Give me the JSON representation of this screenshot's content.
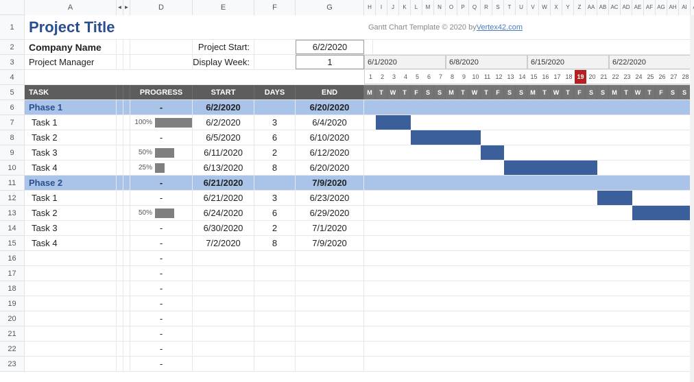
{
  "chart_data": {
    "type": "gantt",
    "title": "Project Title",
    "x_start": "6/1/2020",
    "weeks": [
      "6/1/2020",
      "6/8/2020",
      "6/15/2020",
      "6/22/2020"
    ],
    "today": "6/19/2020",
    "tasks": [
      {
        "name": "Phase 1",
        "type": "phase",
        "start": "6/2/2020",
        "end": "6/20/2020",
        "days": null,
        "progress": null
      },
      {
        "name": "Task 1",
        "type": "task",
        "start": "6/2/2020",
        "end": "6/4/2020",
        "days": 3,
        "progress": 100
      },
      {
        "name": "Task 2",
        "type": "task",
        "start": "6/5/2020",
        "end": "6/10/2020",
        "days": 6,
        "progress": null
      },
      {
        "name": "Task 3",
        "type": "task",
        "start": "6/11/2020",
        "end": "6/12/2020",
        "days": 2,
        "progress": 50
      },
      {
        "name": "Task 4",
        "type": "task",
        "start": "6/13/2020",
        "end": "6/20/2020",
        "days": 8,
        "progress": 25
      },
      {
        "name": "Phase 2",
        "type": "phase",
        "start": "6/21/2020",
        "end": "7/9/2020",
        "days": null,
        "progress": null
      },
      {
        "name": "Task 1",
        "type": "task",
        "start": "6/21/2020",
        "end": "6/23/2020",
        "days": 3,
        "progress": null
      },
      {
        "name": "Task 2",
        "type": "task",
        "start": "6/24/2020",
        "end": "6/29/2020",
        "days": 6,
        "progress": 50
      },
      {
        "name": "Task 3",
        "type": "task",
        "start": "6/30/2020",
        "end": "7/1/2020",
        "days": 2,
        "progress": null
      },
      {
        "name": "Task 4",
        "type": "task",
        "start": "7/2/2020",
        "end": "7/9/2020",
        "days": 8,
        "progress": null
      }
    ]
  },
  "cols_wide": [
    "A",
    "",
    "",
    "D",
    "E",
    "F",
    "G"
  ],
  "cols_narrow": [
    "H",
    "I",
    "J",
    "K",
    "L",
    "M",
    "N",
    "O",
    "P",
    "Q",
    "R",
    "S",
    "T",
    "U",
    "V",
    "W",
    "X",
    "Y",
    "Z",
    "AA",
    "AB",
    "AC",
    "AD",
    "AE",
    "AF",
    "AG",
    "AH",
    "AI",
    "AJ"
  ],
  "collapse_label_left": "◄",
  "collapse_label_right": "►",
  "header": {
    "title": "Project Title",
    "company_label": "Company Name",
    "manager_label": "Project Manager",
    "start_label": "Project Start:",
    "start_value": "6/2/2020",
    "week_label": "Display Week:",
    "week_value": "1",
    "template_note": "Gantt Chart Template © 2020 by ",
    "template_link": "Vertex42.com"
  },
  "weeks": [
    "6/1/2020",
    "6/8/2020",
    "6/15/2020",
    "6/22/2020"
  ],
  "daynums": [
    1,
    2,
    3,
    4,
    5,
    6,
    7,
    8,
    9,
    10,
    11,
    12,
    13,
    14,
    15,
    16,
    17,
    18,
    19,
    20,
    21,
    22,
    23,
    24,
    25,
    26,
    27,
    28
  ],
  "today_index": 18,
  "dow": [
    "M",
    "T",
    "W",
    "T",
    "F",
    "S",
    "S",
    "M",
    "T",
    "W",
    "T",
    "F",
    "S",
    "S",
    "M",
    "T",
    "W",
    "T",
    "F",
    "S",
    "S",
    "M",
    "T",
    "W",
    "T",
    "F",
    "S",
    "S"
  ],
  "th": {
    "task": "TASK",
    "progress": "PROGRESS",
    "start": "START",
    "days": "DAYS",
    "end": "END"
  },
  "tasks": [
    {
      "type": "phase",
      "name": "Phase 1",
      "progress": "-",
      "start": "6/2/2020",
      "days": "",
      "end": "6/20/2020",
      "bar": [
        1,
        19
      ],
      "light": true
    },
    {
      "type": "task",
      "name": "Task 1",
      "progress": 100,
      "start": "6/2/2020",
      "days": "3",
      "end": "6/4/2020",
      "bar": [
        1,
        3
      ]
    },
    {
      "type": "task",
      "name": "Task 2",
      "progress": null,
      "start": "6/5/2020",
      "days": "6",
      "end": "6/10/2020",
      "bar": [
        4,
        9
      ]
    },
    {
      "type": "task",
      "name": "Task 3",
      "progress": 50,
      "start": "6/11/2020",
      "days": "2",
      "end": "6/12/2020",
      "bar": [
        10,
        11
      ]
    },
    {
      "type": "task",
      "name": "Task 4",
      "progress": 25,
      "start": "6/13/2020",
      "days": "8",
      "end": "6/20/2020",
      "bar": [
        12,
        19
      ]
    },
    {
      "type": "phase",
      "name": "Phase 2",
      "progress": "-",
      "start": "6/21/2020",
      "days": "",
      "end": "7/9/2020",
      "bar": [
        20,
        27
      ],
      "light": true
    },
    {
      "type": "task",
      "name": "Task 1",
      "progress": null,
      "start": "6/21/2020",
      "days": "3",
      "end": "6/23/2020",
      "bar": [
        20,
        22
      ]
    },
    {
      "type": "task",
      "name": "Task 2",
      "progress": 50,
      "start": "6/24/2020",
      "days": "6",
      "end": "6/29/2020",
      "bar": [
        23,
        27
      ]
    },
    {
      "type": "task",
      "name": "Task 3",
      "progress": null,
      "start": "6/30/2020",
      "days": "2",
      "end": "7/1/2020",
      "bar": null
    },
    {
      "type": "task",
      "name": "Task 4",
      "progress": null,
      "start": "7/2/2020",
      "days": "8",
      "end": "7/9/2020",
      "bar": null
    }
  ],
  "empty_rows": 8,
  "dash": "-"
}
